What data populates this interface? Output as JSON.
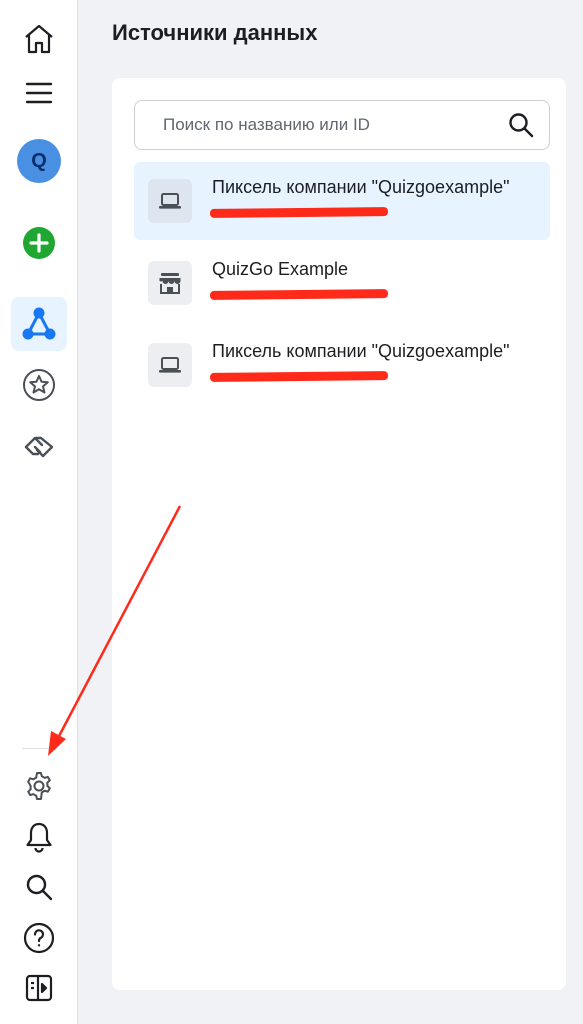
{
  "page": {
    "title": "Источники данных"
  },
  "sidebar": {
    "avatar_letter": "Q",
    "items": [
      {
        "name": "home",
        "icon": "home-icon"
      },
      {
        "name": "menu",
        "icon": "hamburger-icon"
      },
      {
        "name": "account",
        "icon": "avatar"
      },
      {
        "name": "create",
        "icon": "plus-circle-icon"
      },
      {
        "name": "data-sources",
        "icon": "events-manager-icon",
        "active": true
      },
      {
        "name": "favorites",
        "icon": "star-circle-icon"
      },
      {
        "name": "partners",
        "icon": "handshake-icon"
      },
      {
        "name": "settings",
        "icon": "gear-icon"
      },
      {
        "name": "notifications",
        "icon": "bell-icon"
      },
      {
        "name": "search",
        "icon": "search-icon"
      },
      {
        "name": "help",
        "icon": "help-circle-icon"
      },
      {
        "name": "collapse",
        "icon": "panel-toggle-icon"
      }
    ]
  },
  "search": {
    "placeholder": "Поиск по названию или ID",
    "value": ""
  },
  "sources": [
    {
      "title": "Пиксель компании \"Quizgoexample\"",
      "id_text": "",
      "icon": "laptop-icon",
      "selected": true
    },
    {
      "title": "QuizGo Example",
      "id_text": "",
      "icon": "store-icon",
      "selected": false
    },
    {
      "title": "Пиксель компании \"Quizgoexample\"",
      "id_text": "",
      "icon": "laptop-icon",
      "selected": false
    }
  ],
  "colors": {
    "accent": "#1877f2",
    "selected_bg": "#e7f3ff",
    "add_green": "#1fa731",
    "annotation_red": "#ff2a1a"
  }
}
